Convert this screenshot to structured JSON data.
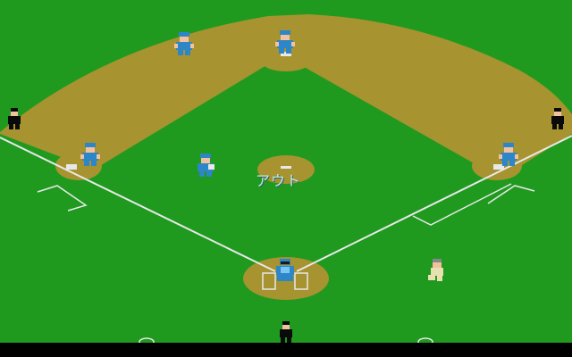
{
  "game": {
    "call_text": "アウト"
  },
  "colors": {
    "grass": "#1f9a1f",
    "dirt": "#a79330",
    "chalk": "#e8e8e8",
    "team_uniform": "#2c86c8",
    "runner_uniform": "#e8e0b0",
    "umpire": "#0a0a0a"
  },
  "sprites": [
    {
      "role": "center-fielder",
      "icon": "fielder-icon"
    },
    {
      "role": "left-center-fielder",
      "icon": "fielder-icon"
    },
    {
      "role": "third-baseman",
      "icon": "fielder-icon"
    },
    {
      "role": "pitcher",
      "icon": "fielder-icon"
    },
    {
      "role": "first-baseman",
      "icon": "fielder-icon"
    },
    {
      "role": "catcher",
      "icon": "catcher-icon"
    },
    {
      "role": "runner",
      "icon": "runner-icon"
    },
    {
      "role": "left-umpire",
      "icon": "umpire-icon"
    },
    {
      "role": "right-umpire",
      "icon": "umpire-icon"
    },
    {
      "role": "home-umpire",
      "icon": "umpire-icon"
    }
  ]
}
